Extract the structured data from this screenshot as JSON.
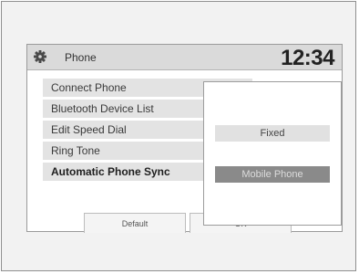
{
  "header": {
    "icon": "gear-icon",
    "title": "Phone",
    "clock": "12:34"
  },
  "menu": {
    "items": [
      {
        "label": "Connect Phone"
      },
      {
        "label": "Bluetooth Device List"
      },
      {
        "label": "Edit Speed Dial"
      },
      {
        "label": "Ring Tone"
      },
      {
        "label": "Automatic Phone Sync",
        "selected": true
      }
    ]
  },
  "buttons": {
    "default_label": "Default",
    "ok_label": "OK"
  },
  "popup": {
    "options": [
      {
        "label": "Fixed",
        "selected": false
      },
      {
        "label": "Mobile Phone",
        "selected": true
      }
    ]
  }
}
